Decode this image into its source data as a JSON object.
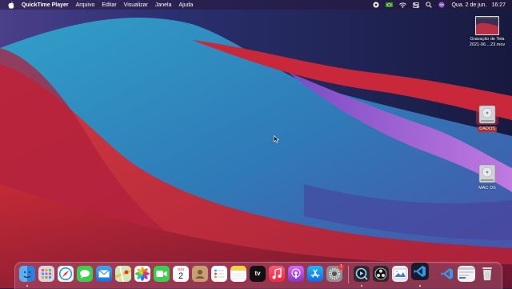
{
  "menubar": {
    "app_name": "QuickTime Player",
    "menus": [
      "Arquivo",
      "Editar",
      "Visualizar",
      "Janela",
      "Ajuda"
    ],
    "clock_date": "Qua. 2 de jun.",
    "clock_time": "16:27"
  },
  "desktop": {
    "file_name_line1": "Gravação de Tela",
    "file_name_line2": "2021-06....23.mov",
    "drive1_label": "DADOS",
    "drive2_label": "MAC OS"
  },
  "dock": {
    "calendar_month": "JUN",
    "calendar_day": "2",
    "tv_label": "tv",
    "system_prefs_badge": "1"
  },
  "colors": {
    "wallpaper_red": "#c8283a",
    "wallpaper_blue": "#2f8fc0",
    "wallpaper_purple": "#a45ad6",
    "selected_label": "#b33333"
  }
}
